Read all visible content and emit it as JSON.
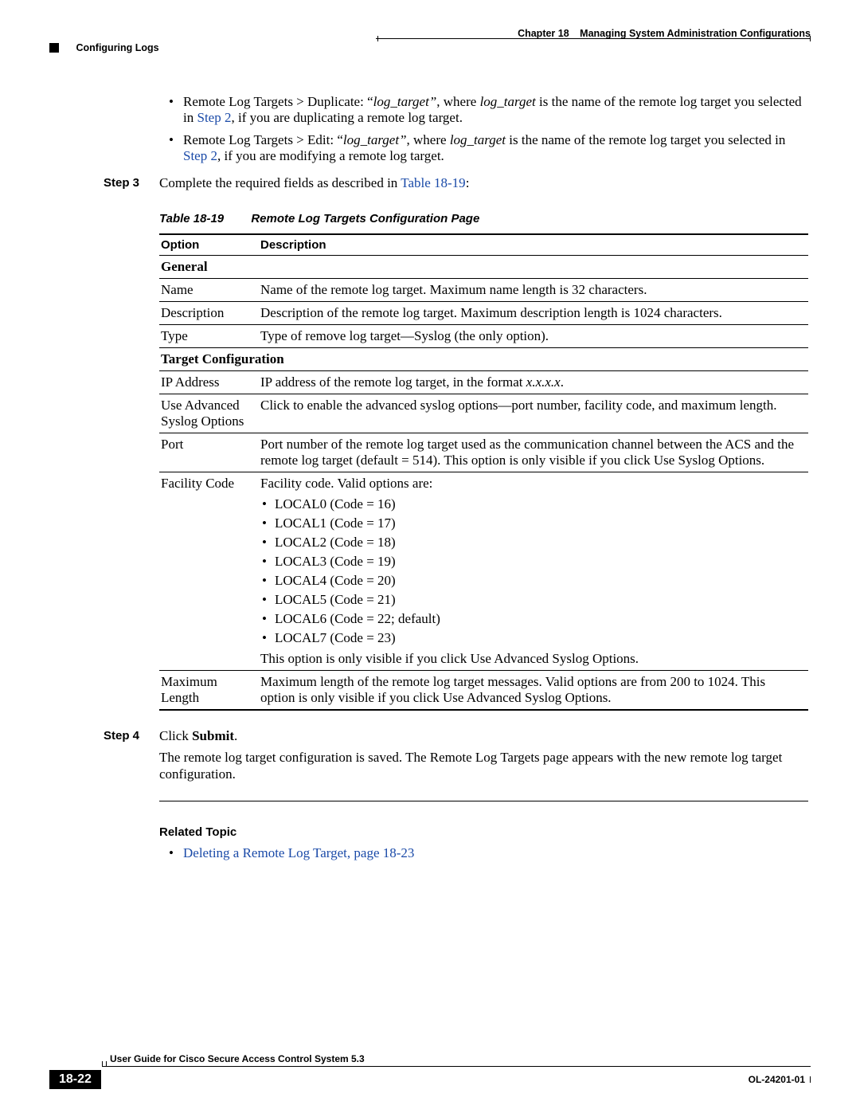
{
  "header": {
    "chapter_label": "Chapter 18",
    "chapter_title": "Managing System Administration Configurations",
    "section": "Configuring Logs"
  },
  "bullets": [
    {
      "prefix": "Remote Log Targets > Duplicate: “",
      "ital1": "log_target”",
      "mid1": ", where ",
      "ital2": "log_target",
      "mid2": " is the name of the remote log target you selected in ",
      "link": "Step 2",
      "tail": ", if you are duplicating a remote log target."
    },
    {
      "prefix": "Remote Log Targets > Edit: “",
      "ital1": "log_target”",
      "mid1": ", where ",
      "ital2": "log_target",
      "mid2": " is the name of the remote log target you selected in ",
      "link": "Step 2",
      "tail": ", if you are modifying a remote log target."
    }
  ],
  "step3": {
    "label": "Step 3",
    "pre": "Complete the required fields as described in ",
    "link": "Table 18-19",
    "post": ":"
  },
  "caption": {
    "id": "Table 18-19",
    "title": "Remote Log Targets Configuration Page"
  },
  "table": {
    "headers": [
      "Option",
      "Description"
    ],
    "section1": "General",
    "r_name": [
      "Name",
      "Name of the remote log target. Maximum name length is 32 characters."
    ],
    "r_desc": [
      "Description",
      "Description of the remote log target. Maximum description length is 1024 characters."
    ],
    "r_type": [
      "Type",
      "Type of remove log target—Syslog (the only option)."
    ],
    "section2": "Target Configuration",
    "r_ip_opt": "IP Address",
    "r_ip_d1": "IP address of the remote log target, in the format ",
    "r_ip_it": "x.x.x.x",
    "r_ip_d2": ".",
    "r_adv": [
      "Use Advanced Syslog Options",
      "Click to enable the advanced syslog options—port number, facility code, and maximum length."
    ],
    "r_port": [
      "Port",
      "Port number of the remote log target used as the communication channel between the ACS and the remote log target (default = 514). This option is only visible if you click Use Syslog Options."
    ],
    "r_fac_opt": "Facility Code",
    "r_fac_lead": "Facility code. Valid options are:",
    "r_fac_items": [
      "LOCAL0 (Code = 16)",
      "LOCAL1 (Code = 17)",
      "LOCAL2 (Code = 18)",
      "LOCAL3 (Code = 19)",
      "LOCAL4 (Code = 20)",
      "LOCAL5 (Code = 21)",
      "LOCAL6 (Code = 22; default)",
      "LOCAL7 (Code = 23)"
    ],
    "r_fac_tail": "This option is only visible if you click Use Advanced Syslog Options.",
    "r_max": [
      "Maximum Length",
      "Maximum length of the remote log target messages. Valid options are from 200 to 1024. This option is only visible if you click Use Advanced Syslog Options."
    ]
  },
  "step4": {
    "label": "Step 4",
    "pre": "Click ",
    "bold": "Submit",
    "post": ".",
    "para": "The remote log target configuration is saved. The Remote Log Targets page appears with the new remote log target configuration."
  },
  "related": {
    "heading": "Related Topic",
    "item": "Deleting a Remote Log Target, page 18-23"
  },
  "footer": {
    "guide": "User Guide for Cisco Secure Access Control System 5.3",
    "page": "18-22",
    "doc": "OL-24201-01"
  }
}
